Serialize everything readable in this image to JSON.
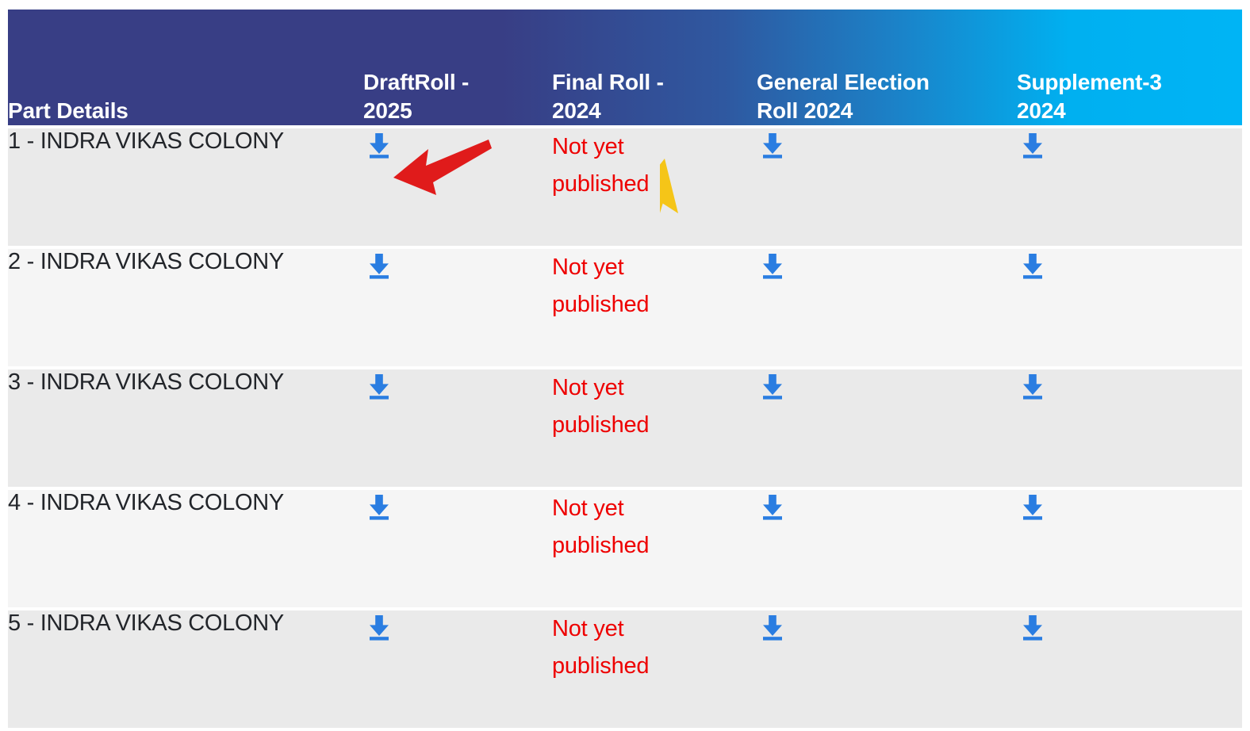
{
  "table": {
    "columns": [
      {
        "key": "part",
        "label": "Part Details"
      },
      {
        "key": "draft",
        "label": "DraftRoll - 2025"
      },
      {
        "key": "final",
        "label": "Final Roll - 2024"
      },
      {
        "key": "gen",
        "label": "General Election Roll 2024"
      },
      {
        "key": "supp",
        "label": "Supplement-3 2024"
      }
    ],
    "header_lines": {
      "part": {
        "line1": "Part Details",
        "line2": ""
      },
      "draft": {
        "line1": "DraftRoll -",
        "line2": "2025"
      },
      "final": {
        "line1": "Final Roll -",
        "line2": "2024"
      },
      "gen": {
        "line1": "General Election",
        "line2": "Roll 2024"
      },
      "supp": {
        "line1": "Supplement-3",
        "line2": "2024"
      }
    },
    "not_published_text": "Not yet published",
    "download_icon_name": "download-icon",
    "rows": [
      {
        "part": "1 - INDRA VIKAS COLONY",
        "draft": "download",
        "final": "Not yet published",
        "gen": "download",
        "supp": "download"
      },
      {
        "part": "2 - INDRA VIKAS COLONY",
        "draft": "download",
        "final": "Not yet published",
        "gen": "download",
        "supp": "download"
      },
      {
        "part": "3 - INDRA VIKAS COLONY",
        "draft": "download",
        "final": "Not yet published",
        "gen": "download",
        "supp": "download"
      },
      {
        "part": "4 - INDRA VIKAS COLONY",
        "draft": "download",
        "final": "Not yet published",
        "gen": "download",
        "supp": "download"
      },
      {
        "part": "5 - INDRA VIKAS COLONY",
        "draft": "download",
        "final": "Not yet published",
        "gen": "download",
        "supp": "download"
      }
    ]
  },
  "annotations": {
    "red_arrow": {
      "name": "red-arrow-annotation",
      "color": "#e01b1b",
      "points_to": "DraftRoll - 2025 download icon, row 1"
    },
    "yellow_cursor": {
      "name": "mouse-cursor-pointer",
      "color": "#f5c518",
      "position_hint": "over Final Roll - 2024 cell, row 1"
    }
  },
  "colors": {
    "header_gradient_start": "#383e85",
    "header_gradient_end": "#00b4f5",
    "row_odd_bg": "#eaeaea",
    "row_even_bg": "#f5f5f5",
    "part_text": "#22252a",
    "not_published_red": "#ee0000",
    "download_blue": "#2a7de1",
    "page_bg": "#ffffff"
  }
}
